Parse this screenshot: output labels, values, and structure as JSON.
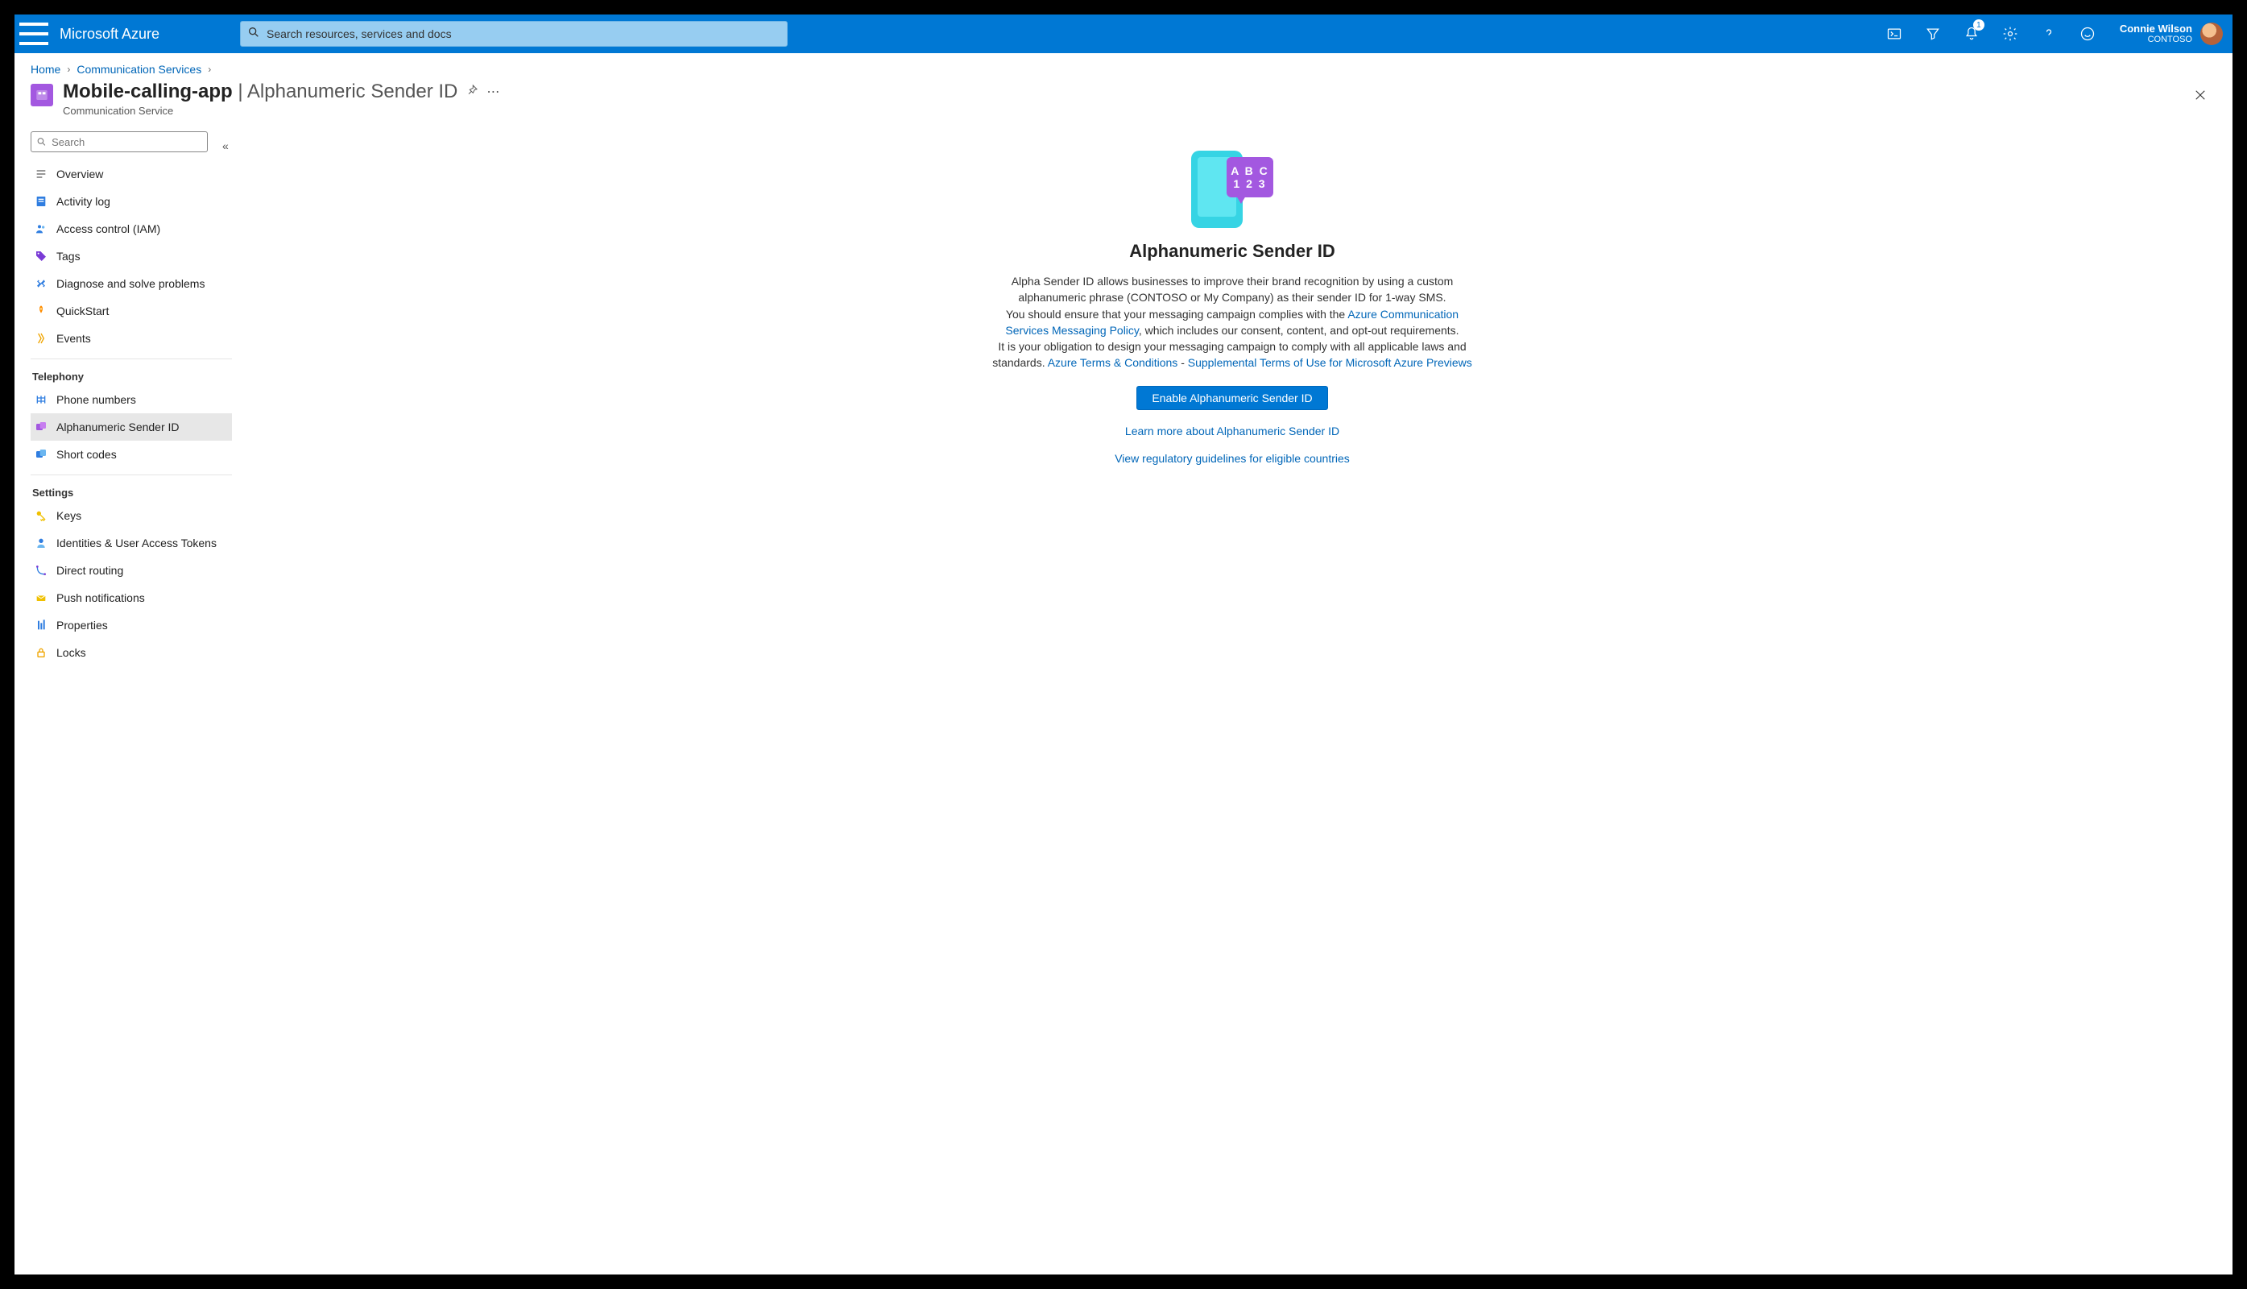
{
  "header": {
    "brand": "Microsoft Azure",
    "search_placeholder": "Search resources, services and docs",
    "notification_badge": "1",
    "user_name": "Connie Wilson",
    "tenant": "CONTOSO"
  },
  "breadcrumbs": {
    "home": "Home",
    "parent": "Communication Services"
  },
  "page": {
    "title_main": "Mobile-calling-app",
    "title_sep": " | ",
    "title_sub": "Alphanumeric Sender ID",
    "subtitle": "Communication Service"
  },
  "side": {
    "search_placeholder": "Search",
    "groups": [
      {
        "label": "",
        "items": [
          "Overview",
          "Activity log",
          "Access control (IAM)",
          "Tags",
          "Diagnose and solve problems",
          "QuickStart",
          "Events"
        ]
      },
      {
        "label": "Telephony",
        "items": [
          "Phone numbers",
          "Alphanumeric Sender ID",
          "Short codes"
        ]
      },
      {
        "label": "Settings",
        "items": [
          "Keys",
          "Identities & User Access Tokens",
          "Direct routing",
          "Push notifications",
          "Properties",
          "Locks"
        ]
      }
    ],
    "selected": "Alphanumeric Sender ID"
  },
  "main": {
    "heading": "Alphanumeric Sender ID",
    "p1": "Alpha Sender ID allows businesses to improve their brand recognition by using a custom alphanumeric phrase (CONTOSO or My Company) as their sender ID for 1-way SMS.",
    "p2a": "You should ensure that your messaging campaign complies with the ",
    "link_policy": "Azure Communication Services Messaging Policy",
    "p2b": ", which includes our consent, content, and opt-out requirements.",
    "p3a": "It is your obligation to design your messaging campaign to comply with all applicable laws and standards. ",
    "link_terms": "Azure Terms & Conditions",
    "dash": " - ",
    "link_supp": "Supplemental Terms of Use for Microsoft Azure Previews",
    "button": "Enable Alphanumeric Sender ID",
    "link_learn": "Learn more about Alphanumeric Sender ID",
    "link_reg": "View regulatory guidelines for eligible countries",
    "abc_line1": "A B C",
    "abc_line2": "1 2 3"
  }
}
